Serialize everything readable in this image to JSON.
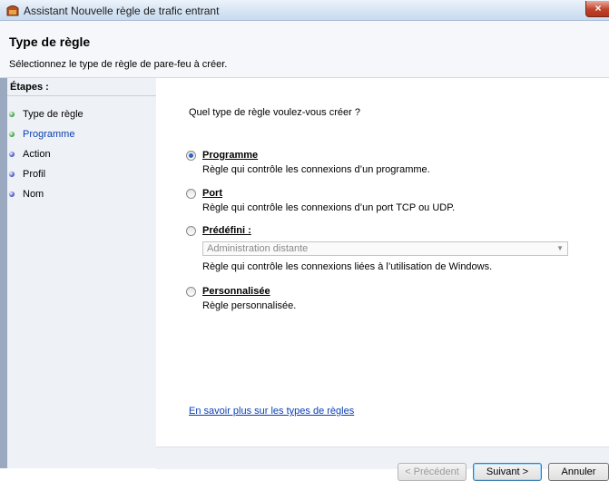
{
  "window": {
    "title": "Assistant Nouvelle règle de trafic entrant",
    "close_glyph": "×"
  },
  "header": {
    "title": "Type de règle",
    "subtitle": "Sélectionnez le type de règle de pare-feu à créer."
  },
  "sidebar": {
    "heading": "Étapes :",
    "steps": [
      {
        "label": "Type de règle",
        "state": "done",
        "dot_color": "#3da845",
        "text_color": "#000000"
      },
      {
        "label": "Programme",
        "state": "current",
        "dot_color": "#3da845",
        "text_color": "#0a3fb2"
      },
      {
        "label": "Action",
        "state": "pending",
        "dot_color": "#4a5bc7",
        "text_color": "#000000"
      },
      {
        "label": "Profil",
        "state": "pending",
        "dot_color": "#4a5bc7",
        "text_color": "#000000"
      },
      {
        "label": "Nom",
        "state": "pending",
        "dot_color": "#4a5bc7",
        "text_color": "#000000"
      }
    ]
  },
  "main": {
    "question": "Quel type de règle voulez-vous créer ?",
    "options": [
      {
        "label": "Programme",
        "description": "Règle qui contrôle les connexions d’un programme.",
        "selected": true
      },
      {
        "label": "Port",
        "description": "Règle qui contrôle les connexions d’un port TCP ou UDP.",
        "selected": false
      },
      {
        "label": "Prédéfini :",
        "description": "Règle qui contrôle les connexions liées à l’utilisation de Windows.",
        "selected": false
      },
      {
        "label": "Personnalisée",
        "description": "Règle personnalisée.",
        "selected": false
      }
    ],
    "predefined_select": {
      "value": "Administration distante",
      "disabled": true
    },
    "learn_more_link": "En savoir plus sur les types de règles"
  },
  "footer": {
    "back_label": "< Précédent",
    "next_label": "Suivant >",
    "cancel_label": "Annuler"
  }
}
